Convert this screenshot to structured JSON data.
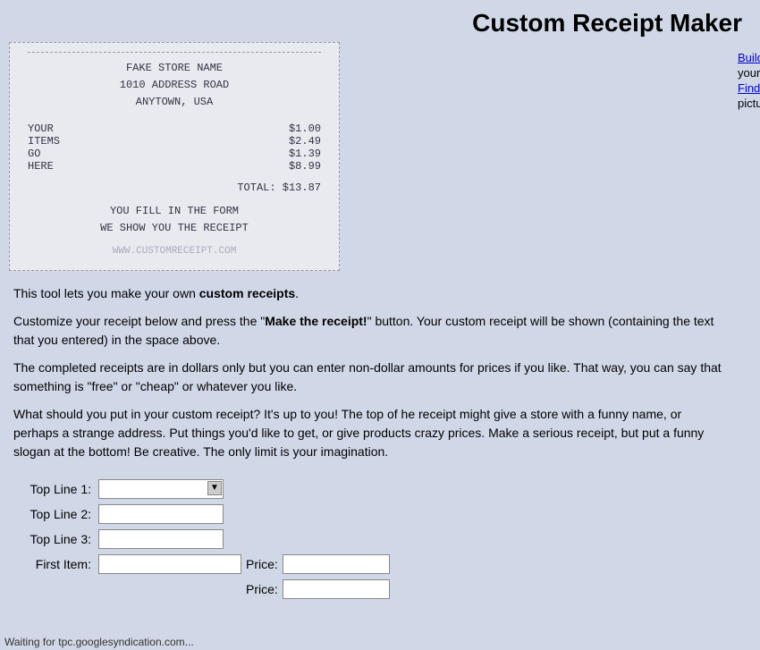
{
  "header": {
    "title": "Custom Receipt Maker"
  },
  "receipt": {
    "store_name": "FAKE STORE NAME",
    "address1": "1010 ADDRESS ROAD",
    "address2": "ANYTOWN, USA",
    "items": [
      {
        "label": "YOUR",
        "price": "$1.00"
      },
      {
        "label": "ITEMS",
        "price": "$2.49"
      },
      {
        "label": "GO",
        "price": "$1.39"
      },
      {
        "label": "HERE",
        "price": "$8.99"
      }
    ],
    "total_label": "TOTAL:",
    "total_value": "$13.87",
    "footer_line1": "YOU FILL IN THE FORM",
    "footer_line2": "WE SHOW YOU THE RECEIPT",
    "url": "WWW.CUSTOMRECEIPT.COM"
  },
  "description": {
    "para1_prefix": "This tool lets you make your own ",
    "para1_bold": "custom receipts",
    "para1_suffix": ".",
    "para2": "Customize your receipt below and press the \"Make the receipt!\" button. Your custom receipt will be shown (containing the text that you entered) in the space above.",
    "para2_bold": "Make the receipt!",
    "para3": "The completed receipts are in dollars only but you can enter non-dollar amounts for prices if you like. That way, you can say that something is \"free\" or \"cheap\" or whatever you like.",
    "para4": "What should you put in your custom receipt? It's up to you! The top of he receipt might give a store with a funny name, or perhaps a strange address. Put things you'd like to get, or give products crazy prices. Make a serious receipt, but put a funny slogan at the bottom! Be creative. The only limit is your imagination."
  },
  "sidebar": {
    "link1_label": "Build",
    "link1_text": "your",
    "link2_label": "Find",
    "link2_text": "pictu"
  },
  "form": {
    "top_line1_label": "Top Line 1:",
    "top_line2_label": "Top Line 2:",
    "top_line3_label": "Top Line 3:",
    "first_item_label": "First Item:",
    "price_label": "Price:",
    "second_price_label": "Price:",
    "top_line1_value": "",
    "top_line2_value": "",
    "top_line3_value": "",
    "first_item_value": "",
    "first_price_value": "",
    "second_price_value": ""
  },
  "status_bar": {
    "text": "Waiting for tpc.googlesyndication.com..."
  }
}
